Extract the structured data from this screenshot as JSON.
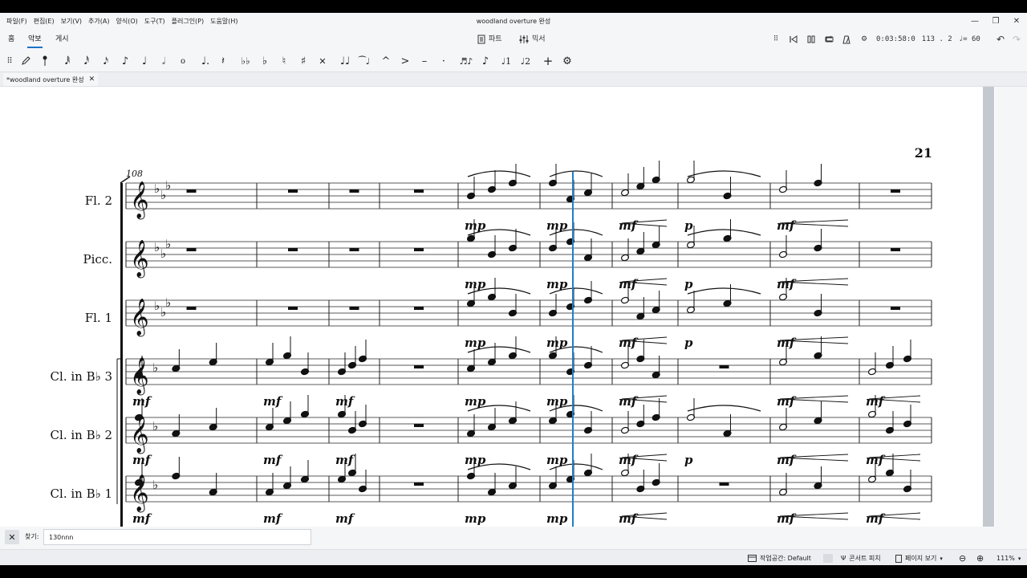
{
  "app": {
    "window_title": "woodland overture 완성",
    "menu": [
      "파일(F)",
      "편집(E)",
      "보기(V)",
      "추가(A)",
      "양식(O)",
      "도구(T)",
      "플러그인(P)",
      "도움말(H)"
    ]
  },
  "tabs": {
    "home": "홈",
    "score": "악보",
    "publish": "게시"
  },
  "center": {
    "parts": "파트",
    "mixer": "믹서"
  },
  "playback": {
    "time": "0:03:58:0",
    "position": "113 . 2",
    "tempo": "= 60"
  },
  "document_tab": {
    "label": "*woodland overture 완성"
  },
  "score": {
    "page_number": "21",
    "measure_number": "108",
    "instruments": [
      "Fl. 2",
      "Picc.",
      "Fl. 1",
      "Cl. in B♭ 3",
      "Cl. in B♭ 2",
      "Cl. in B♭ 1"
    ],
    "dynamics": [
      "mf",
      "mp",
      "p"
    ]
  },
  "find": {
    "label": "찾기:",
    "value": "130nnn"
  },
  "status": {
    "workspace": "작업공간: Default",
    "concert_pitch": "콘서트 피치",
    "page_view": "페이지 보기",
    "zoom": "111%"
  },
  "colors": {
    "accent": "#1a73c8",
    "playhead": "#1f7fc9",
    "scrollbar": "#c4c9d0"
  },
  "icons": [
    "pencil-icon",
    "undo-icon",
    "redo-icon",
    "settings-icon",
    "metronome-icon",
    "rewind-icon",
    "play-icon",
    "loop-icon",
    "zoom-in-icon",
    "zoom-out-icon",
    "close-icon"
  ]
}
